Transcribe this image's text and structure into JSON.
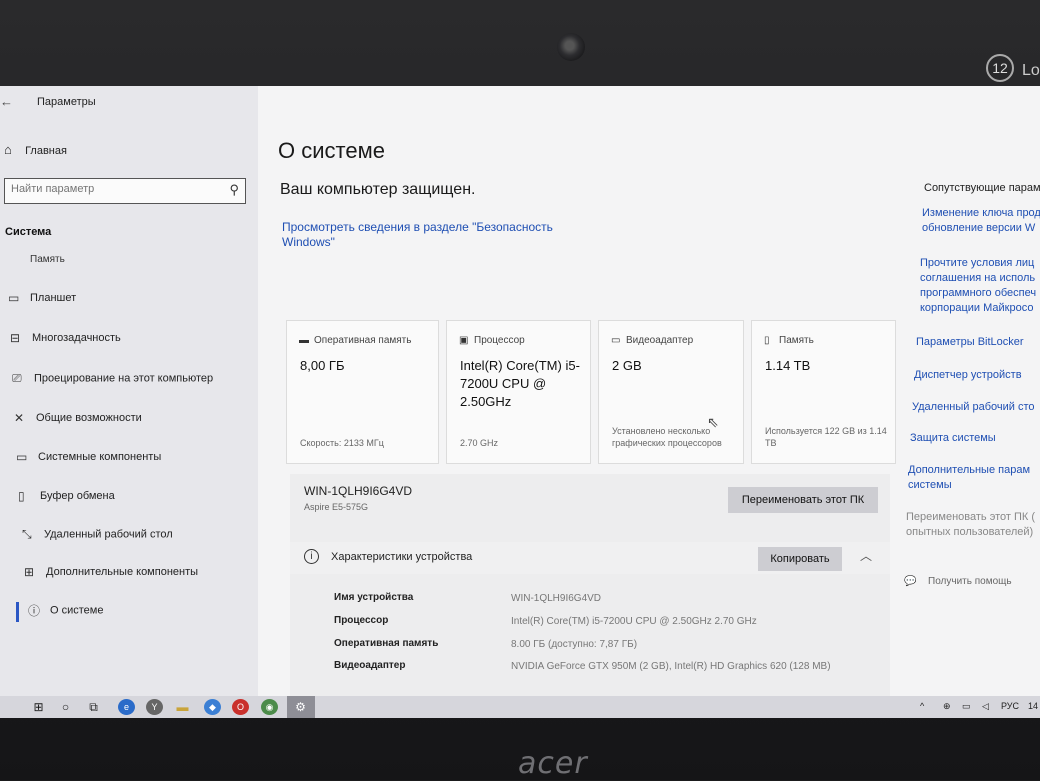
{
  "bezel": {
    "brand": "acer",
    "sticker_number": "12",
    "sticker_text": "Lo"
  },
  "window": {
    "title": "Параметры"
  },
  "sidebar": {
    "home": "Главная",
    "search_placeholder": "Найти параметр",
    "section": "Система",
    "cut_item": "Память",
    "items": [
      {
        "label": "Планшет",
        "icon": "tablet-icon"
      },
      {
        "label": "Многозадачность",
        "icon": "multitask-icon"
      },
      {
        "label": "Проецирование на этот компьютер",
        "icon": "project-icon"
      },
      {
        "label": "Общие возможности",
        "icon": "shared-icon"
      },
      {
        "label": "Системные компоненты",
        "icon": "components-icon"
      },
      {
        "label": "Буфер обмена",
        "icon": "clipboard-icon"
      },
      {
        "label": "Удаленный рабочий стол",
        "icon": "remote-desktop-icon"
      },
      {
        "label": "Дополнительные компоненты",
        "icon": "optional-features-icon"
      },
      {
        "label": "О системе",
        "icon": "info-icon"
      }
    ]
  },
  "main": {
    "title": "О системе",
    "protected": "Ваш компьютер защищен.",
    "security_link": "Просмотреть сведения в разделе \"Безопасность Windows\"",
    "cards": [
      {
        "header": "Оперативная память",
        "value": "8,00 ГБ",
        "sub": "Скорость: 2133 МГц"
      },
      {
        "header": "Процессор",
        "value": "Intel(R) Core(TM) i5-7200U CPU @ 2.50GHz",
        "sub": "2.70 GHz"
      },
      {
        "header": "Видеоадаптер",
        "value": "2 GB",
        "sub": "Установлено несколько графических процессоров"
      },
      {
        "header": "Память",
        "value": "1.14 TB",
        "sub": "Используется 122 GB из 1.14 TB"
      }
    ],
    "pc_name": "WIN-1QLH9I6G4VD",
    "pc_model": "Aspire E5-575G",
    "rename_button": "Переименовать этот ПК",
    "specs_title": "Характеристики устройства",
    "copy_button": "Копировать",
    "specs": [
      {
        "key": "Имя устройства",
        "value": "WIN-1QLH9I6G4VD"
      },
      {
        "key": "Процессор",
        "value": "Intel(R) Core(TM) i5-7200U CPU @ 2.50GHz   2.70 GHz"
      },
      {
        "key": "Оперативная память",
        "value": "8.00 ГБ (доступно: 7,87 ГБ)"
      },
      {
        "key": "Видеоадаптер",
        "value": "NVIDIA GeForce GTX 950M (2 GB), Intel(R) HD Graphics 620 (128 MB)"
      }
    ]
  },
  "related": {
    "title": "Сопутствующие парам",
    "links": [
      "Изменение ключа прод\nобновление версии W",
      "Прочтите условия лиц\nсоглашения на исполь\nпрограммного обеспеч\nкорпорации Майкросо",
      "Параметры BitLocker",
      "Диспетчер устройств",
      "Удаленный рабочий сто",
      "Защита системы",
      "Дополнительные парам\nсистемы",
      "Переименовать этот ПК (\nопытных пользователей)"
    ],
    "help": "Получить помощь"
  },
  "taskbar": {
    "apps": [
      "start-icon",
      "search-icon",
      "task-view-icon",
      "edge-icon",
      "yandex-icon",
      "file-explorer-icon",
      "vpn-icon",
      "opera-icon",
      "chrome-icon",
      "settings-icon"
    ],
    "language": "РУС",
    "clock": "14"
  }
}
